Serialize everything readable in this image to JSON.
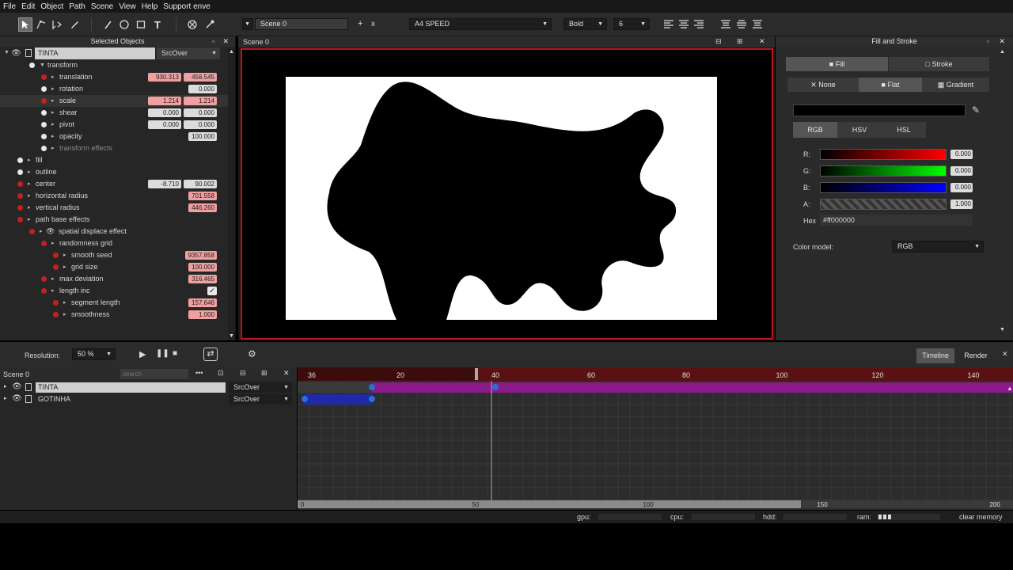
{
  "menu": [
    "File",
    "Edit",
    "Object",
    "Path",
    "Scene",
    "View",
    "Help",
    "Support enve"
  ],
  "toolbar": {
    "scene_name": "Scene 0",
    "scene_add": "+",
    "scene_remove": "x",
    "font_family": "A4 SPEED",
    "font_style": "Bold",
    "font_size": "6"
  },
  "selected_objects": {
    "title": "Selected Objects",
    "object": {
      "name": "TINTA",
      "blend": "SrcOver"
    },
    "properties": [
      {
        "label": "transform",
        "indent": 1,
        "dot": "w",
        "expanded": true,
        "values": []
      },
      {
        "label": "translation",
        "indent": 2,
        "dot": "r",
        "values": [
          "930.313",
          "456.545"
        ],
        "pink": [
          true,
          true
        ]
      },
      {
        "label": "rotation",
        "indent": 2,
        "dot": "w",
        "values": [
          "0.000"
        ],
        "pink": [
          false
        ]
      },
      {
        "label": "scale",
        "indent": 2,
        "dot": "r",
        "values": [
          "1.214",
          "1.214"
        ],
        "pink": [
          true,
          true
        ]
      },
      {
        "label": "shear",
        "indent": 2,
        "dot": "w",
        "values": [
          "0.000",
          "0.000"
        ],
        "pink": [
          false,
          false
        ]
      },
      {
        "label": "pivot",
        "indent": 2,
        "dot": "w",
        "values": [
          "0.000",
          "0.000"
        ],
        "pink": [
          false,
          false
        ]
      },
      {
        "label": "opacity",
        "indent": 2,
        "dot": "w",
        "values": [
          "100.000"
        ],
        "pink": [
          false
        ]
      },
      {
        "label": "transform effects",
        "indent": 2,
        "dot": "w",
        "values": [],
        "dim": true
      },
      {
        "label": "fill",
        "indent": 0,
        "dot": "w",
        "values": []
      },
      {
        "label": "outline",
        "indent": 0,
        "dot": "w",
        "values": []
      },
      {
        "label": "center",
        "indent": 0,
        "dot": "r",
        "values": [
          "-8.710",
          "90.002"
        ],
        "pink": [
          false,
          false
        ]
      },
      {
        "label": "horizontal radius",
        "indent": 0,
        "dot": "r",
        "values": [
          "701.558"
        ],
        "pink": [
          true
        ]
      },
      {
        "label": "vertical radius",
        "indent": 0,
        "dot": "r",
        "values": [
          "446.260"
        ],
        "pink": [
          true
        ]
      },
      {
        "label": "path base effects",
        "indent": 0,
        "dot": "r",
        "values": []
      },
      {
        "label": "spatial displace effect",
        "indent": 1,
        "dot": "r",
        "values": []
      },
      {
        "label": "randomness grid",
        "indent": 2,
        "dot": "r",
        "values": []
      },
      {
        "label": "smooth seed",
        "indent": 3,
        "dot": "r",
        "values": [
          "9357.858"
        ],
        "pink": [
          true
        ]
      },
      {
        "label": "grid size",
        "indent": 3,
        "dot": "r",
        "values": [
          "100.000"
        ],
        "pink": [
          true
        ]
      },
      {
        "label": "max deviation",
        "indent": 2,
        "dot": "r",
        "values": [
          "316.465"
        ],
        "pink": [
          true
        ]
      },
      {
        "label": "length inc",
        "indent": 2,
        "dot": "r",
        "values": [],
        "checkbox": true
      },
      {
        "label": "segment length",
        "indent": 3,
        "dot": "r",
        "values": [
          "157.646"
        ],
        "pink": [
          true
        ]
      },
      {
        "label": "smoothness",
        "indent": 3,
        "dot": "r",
        "values": [
          "1.000"
        ],
        "pink": [
          true
        ]
      }
    ]
  },
  "canvas": {
    "title": "Scene 0"
  },
  "fill_stroke": {
    "title": "Fill and Stroke",
    "tab_fill": "Fill",
    "tab_stroke": "Stroke",
    "mode_none": "None",
    "mode_flat": "Flat",
    "mode_gradient": "Gradient",
    "model_rgb": "RGB",
    "model_hsv": "HSV",
    "model_hsl": "HSL",
    "r_label": "R:",
    "r_value": "0.000",
    "g_label": "G:",
    "g_value": "0.000",
    "b_label": "B:",
    "b_value": "0.000",
    "a_label": "A:",
    "a_value": "1.000",
    "hex_label": "Hex",
    "hex_value": "#ff000000",
    "color_model_label": "Color model:",
    "color_model_value": "RGB",
    "current_color": "#000000"
  },
  "playback": {
    "resolution_label": "Resolution:",
    "resolution_value": "50 %",
    "tab_timeline": "Timeline",
    "tab_render": "Render"
  },
  "layers": {
    "scene": "Scene 0",
    "search_placeholder": "search",
    "items": [
      {
        "name": "TINTA",
        "blend": "SrcOver"
      },
      {
        "name": "GOTINHA",
        "blend": "SrcOver"
      }
    ]
  },
  "timeline": {
    "ruler_labels": [
      "36",
      "20",
      "40",
      "60",
      "80",
      "100",
      "120",
      "140"
    ],
    "bottom_labels": [
      "0",
      "50",
      "100",
      "150",
      "200"
    ],
    "current_frame_label": "40"
  },
  "status": {
    "gpu": "gpu:",
    "cpu": "cpu:",
    "hdd": "hdd:",
    "ram": "ram:",
    "clear": "clear memory"
  }
}
